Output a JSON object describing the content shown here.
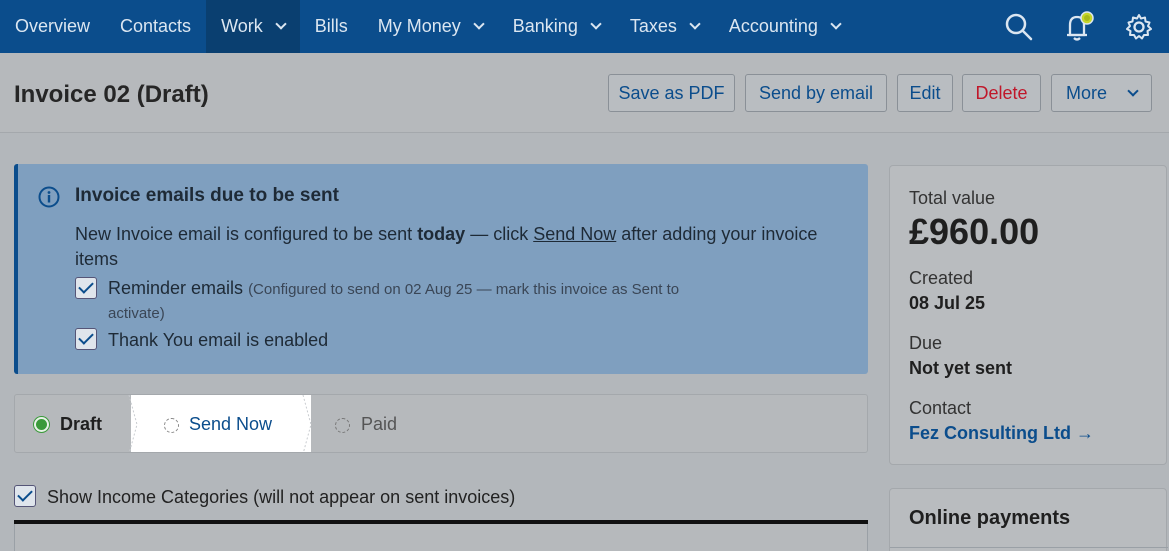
{
  "nav": {
    "items": [
      {
        "label": "Overview",
        "dropdown": false,
        "active": false
      },
      {
        "label": "Contacts",
        "dropdown": false,
        "active": false
      },
      {
        "label": "Work",
        "dropdown": true,
        "active": true
      },
      {
        "label": "Bills",
        "dropdown": false,
        "active": false
      },
      {
        "label": "My Money",
        "dropdown": true,
        "active": false
      },
      {
        "label": "Banking",
        "dropdown": true,
        "active": false
      },
      {
        "label": "Taxes",
        "dropdown": true,
        "active": false
      },
      {
        "label": "Accounting",
        "dropdown": true,
        "active": false
      }
    ],
    "icons": [
      "search-icon",
      "notification-bell-icon",
      "settings-gear-icon"
    ]
  },
  "header": {
    "title": "Invoice 02 (Draft)",
    "buttons": {
      "save_pdf": "Save as PDF",
      "send_email": "Send by email",
      "edit": "Edit",
      "delete": "Delete",
      "more": "More"
    }
  },
  "alert": {
    "title": "Invoice emails due to be sent",
    "line1_a": "New Invoice email is configured to be sent ",
    "line1_b": "today",
    "line1_c": " — click ",
    "line1_link": "Send Now",
    "line1_d": " after adding your invoice items",
    "reminder_label": "Reminder emails",
    "reminder_note_1": "(Configured to send on 02 Aug 25 — mark this invoice as Sent to",
    "reminder_note_2": "activate)",
    "thankyou_label": "Thank You email is enabled"
  },
  "steps": {
    "draft": "Draft",
    "send_now": "Send Now",
    "paid": "Paid"
  },
  "income": {
    "label": "Show Income Categories (will not appear on sent invoices)",
    "checked": true
  },
  "summary": {
    "total_label": "Total value",
    "total_value": "£960.00",
    "created_label": "Created",
    "created_value": "08 Jul 25",
    "due_label": "Due",
    "due_value": "Not yet sent",
    "contact_label": "Contact",
    "contact_value": "Fez Consulting Ltd →"
  },
  "online_payments": {
    "title": "Online payments"
  },
  "colors": {
    "nav_bg": "#0b4d8c",
    "link": "#0b4d8c",
    "danger": "#c0172a",
    "draft_green": "#3a9a3a"
  }
}
